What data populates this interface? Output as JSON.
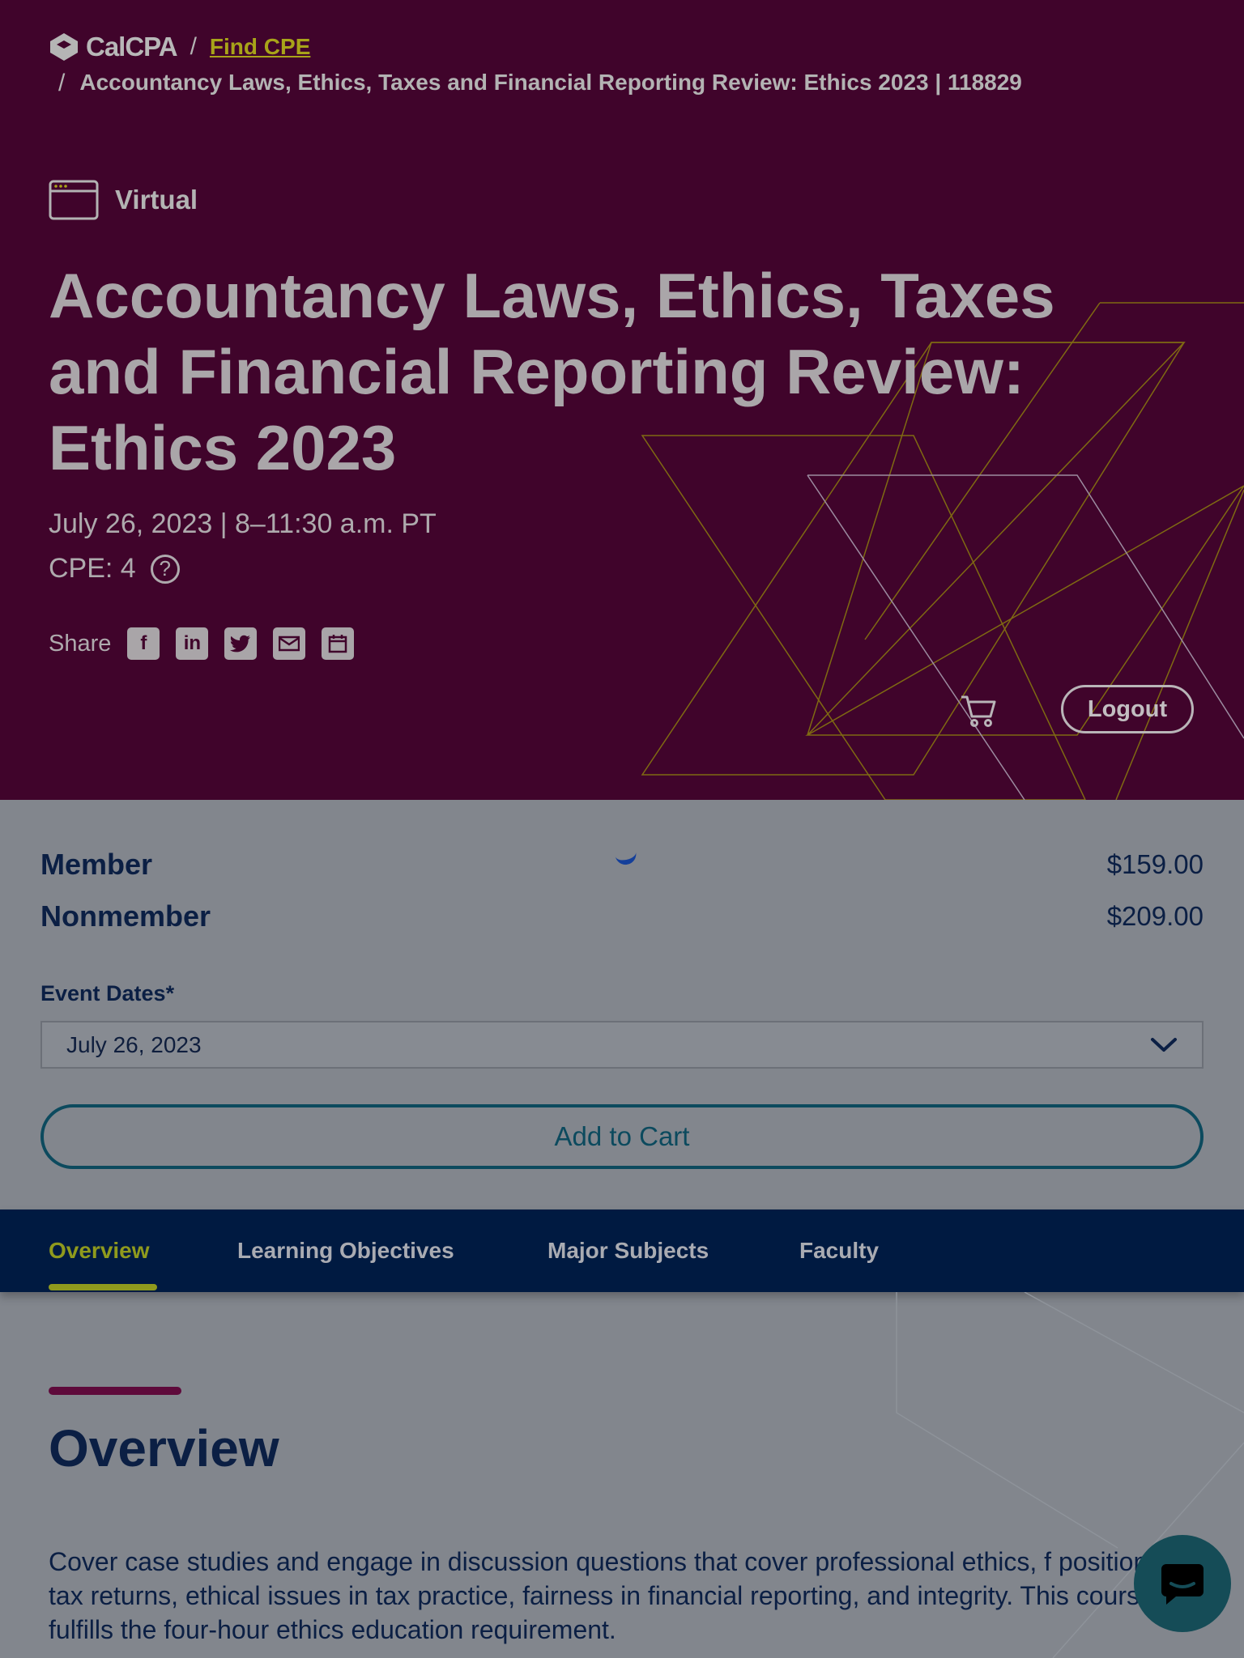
{
  "breadcrumb": {
    "logo_text": "CalCPA",
    "separator": "/",
    "find_cpe": "Find CPE",
    "current": "Accountancy Laws, Ethics, Taxes and Financial Reporting Review: Ethics 2023 | 118829"
  },
  "event": {
    "format": "Virtual",
    "title": "Accountancy Laws, Ethics, Taxes and Financial Reporting Review: Ethics 2023",
    "date_time": "July 26, 2023 | 8–11:30 a.m. PT",
    "cpe": "CPE: 4",
    "cpe_help": "?"
  },
  "share": {
    "label": "Share",
    "icons": [
      "facebook-icon",
      "linkedin-icon",
      "twitter-icon",
      "email-icon",
      "calendar-icon"
    ]
  },
  "header_actions": {
    "logout": "Logout"
  },
  "pricing": [
    {
      "label": "Member",
      "price": "$159.00"
    },
    {
      "label": "Nonmember",
      "price": "$209.00"
    }
  ],
  "event_dates": {
    "label": "Event Dates*",
    "selected": "July 26, 2023"
  },
  "add_to_cart": "Add to Cart",
  "tabs": [
    "Overview",
    "Learning Objectives",
    "Major Subjects",
    "Faculty"
  ],
  "overview": {
    "heading": "Overview",
    "text": "Cover case studies and engage in discussion questions that cover professional ethics, f positions in tax returns, ethical issues in tax practice, fairness in financial reporting, and integrity. This course fulfills the four-hour ethics education requirement."
  },
  "colors": {
    "hero_bg": "#40042b",
    "accent": "#8f9a1d",
    "tab_bar": "#001a41",
    "text_dark": "#0b1f44"
  }
}
